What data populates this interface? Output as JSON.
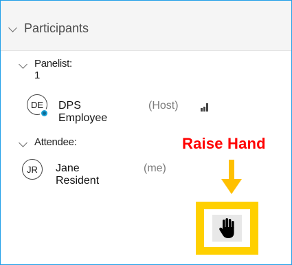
{
  "header": {
    "title": "Participants"
  },
  "panelist_section": {
    "label": "Panelist: 1"
  },
  "panelists": [
    {
      "initials": "DE",
      "name": "DPS Employee",
      "role": "(Host)"
    }
  ],
  "attendee_section": {
    "label": "Attendee:"
  },
  "attendees": [
    {
      "initials": "JR",
      "name": "Jane Resident",
      "role": "(me)"
    }
  ],
  "annotation": {
    "text": "Raise Hand",
    "color": "#ff0000",
    "highlight_color": "#ffd000"
  },
  "icons": {
    "collapse": "chevron-down-icon",
    "presence": "presence-badge-icon",
    "audio": "audio-level-icon",
    "raise_hand": "raise-hand-icon",
    "arrow": "arrow-down-icon"
  }
}
